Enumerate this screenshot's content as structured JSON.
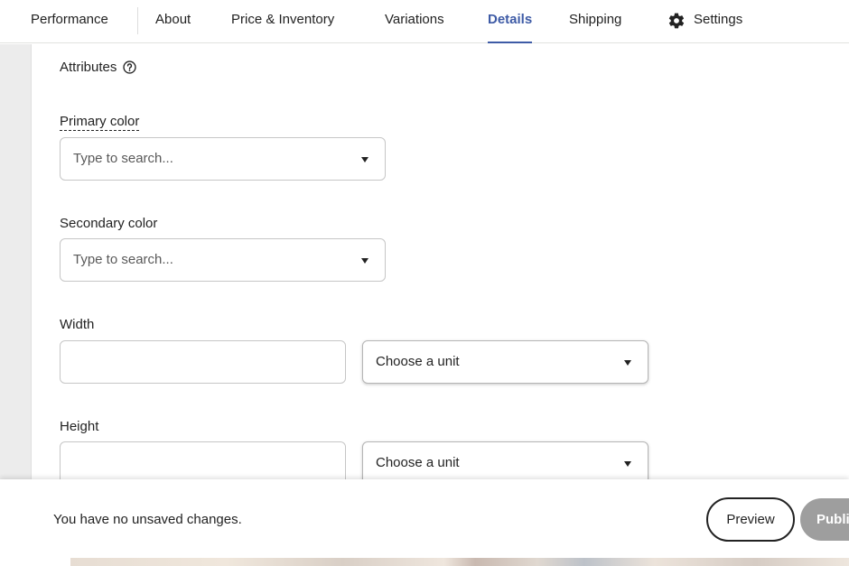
{
  "tabs": [
    {
      "label": "Performance"
    },
    {
      "label": "About"
    },
    {
      "label": "Price & Inventory"
    },
    {
      "label": "Variations"
    },
    {
      "label": "Details",
      "active": true
    },
    {
      "label": "Shipping"
    },
    {
      "label": "Settings",
      "icon": "gear-icon"
    }
  ],
  "attributes": {
    "heading": "Attributes",
    "help_icon": "question-circle-icon",
    "primary_color": {
      "label": "Primary color",
      "placeholder": "Type to search..."
    },
    "secondary_color": {
      "label": "Secondary color",
      "placeholder": "Type to search..."
    },
    "width": {
      "label": "Width",
      "value": "",
      "unit_placeholder": "Choose a unit"
    },
    "height": {
      "label": "Height",
      "value": "",
      "unit_placeholder": "Choose a unit"
    }
  },
  "footer": {
    "status": "You have no unsaved changes.",
    "preview_label": "Preview",
    "publish_label": "Publish"
  },
  "colors": {
    "accent": "#3e5ba6",
    "publish_disabled": "#9e9e9e"
  }
}
